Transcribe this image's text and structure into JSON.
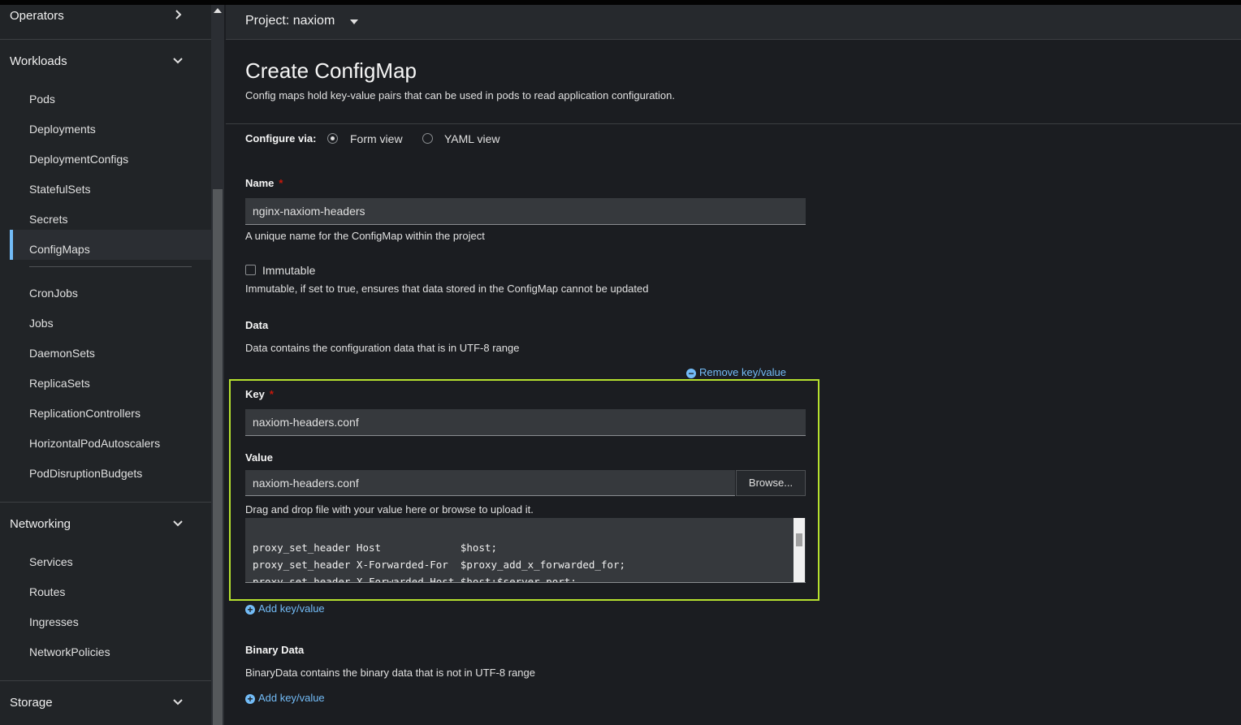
{
  "sidebar": {
    "operators": "Operators",
    "workloads": {
      "label": "Workloads",
      "items": [
        "Pods",
        "Deployments",
        "DeploymentConfigs",
        "StatefulSets",
        "Secrets",
        "ConfigMaps",
        "CronJobs",
        "Jobs",
        "DaemonSets",
        "ReplicaSets",
        "ReplicationControllers",
        "HorizontalPodAutoscalers",
        "PodDisruptionBudgets"
      ],
      "active": "ConfigMaps"
    },
    "networking": {
      "label": "Networking",
      "items": [
        "Services",
        "Routes",
        "Ingresses",
        "NetworkPolicies"
      ]
    },
    "storage": "Storage"
  },
  "header": {
    "project": "Project: naxiom"
  },
  "page": {
    "title": "Create ConfigMap",
    "description": "Config maps hold key-value pairs that can be used in pods to read application configuration."
  },
  "configure": {
    "label": "Configure via:",
    "form_view": "Form view",
    "yaml_view": "YAML view",
    "selected": "Form view"
  },
  "name": {
    "label": "Name",
    "required": "*",
    "value": "nginx-naxiom-headers",
    "helper": "A unique name for the ConfigMap within the project"
  },
  "immutable": {
    "label": "Immutable",
    "helper": "Immutable, if set to true, ensures that data stored in the ConfigMap cannot be updated"
  },
  "data": {
    "label": "Data",
    "helper": "Data contains the configuration data that is in UTF-8 range",
    "remove_label": "Remove key/value",
    "key_label": "Key",
    "key_required": "*",
    "key_value": "naxiom-headers.conf",
    "value_label": "Value",
    "file_name": "naxiom-headers.conf",
    "browse_label": "Browse...",
    "drag_helper": "Drag and drop file with your value here or browse to upload it.",
    "code_lines": [
      "proxy_set_header Host             $host;",
      "proxy_set_header X-Forwarded-For  $proxy_add_x_forwarded_for;",
      "proxy_set_header X-Forwarded-Host $host:$server_port;"
    ],
    "add_label": "Add key/value"
  },
  "binary": {
    "label": "Binary Data",
    "helper": "BinaryData contains the binary data that is not in UTF-8 range",
    "add_label": "Add key/value"
  },
  "colors": {
    "accent": "#73bcf7",
    "highlight": "#b6e12f",
    "required": "#c9190b"
  }
}
